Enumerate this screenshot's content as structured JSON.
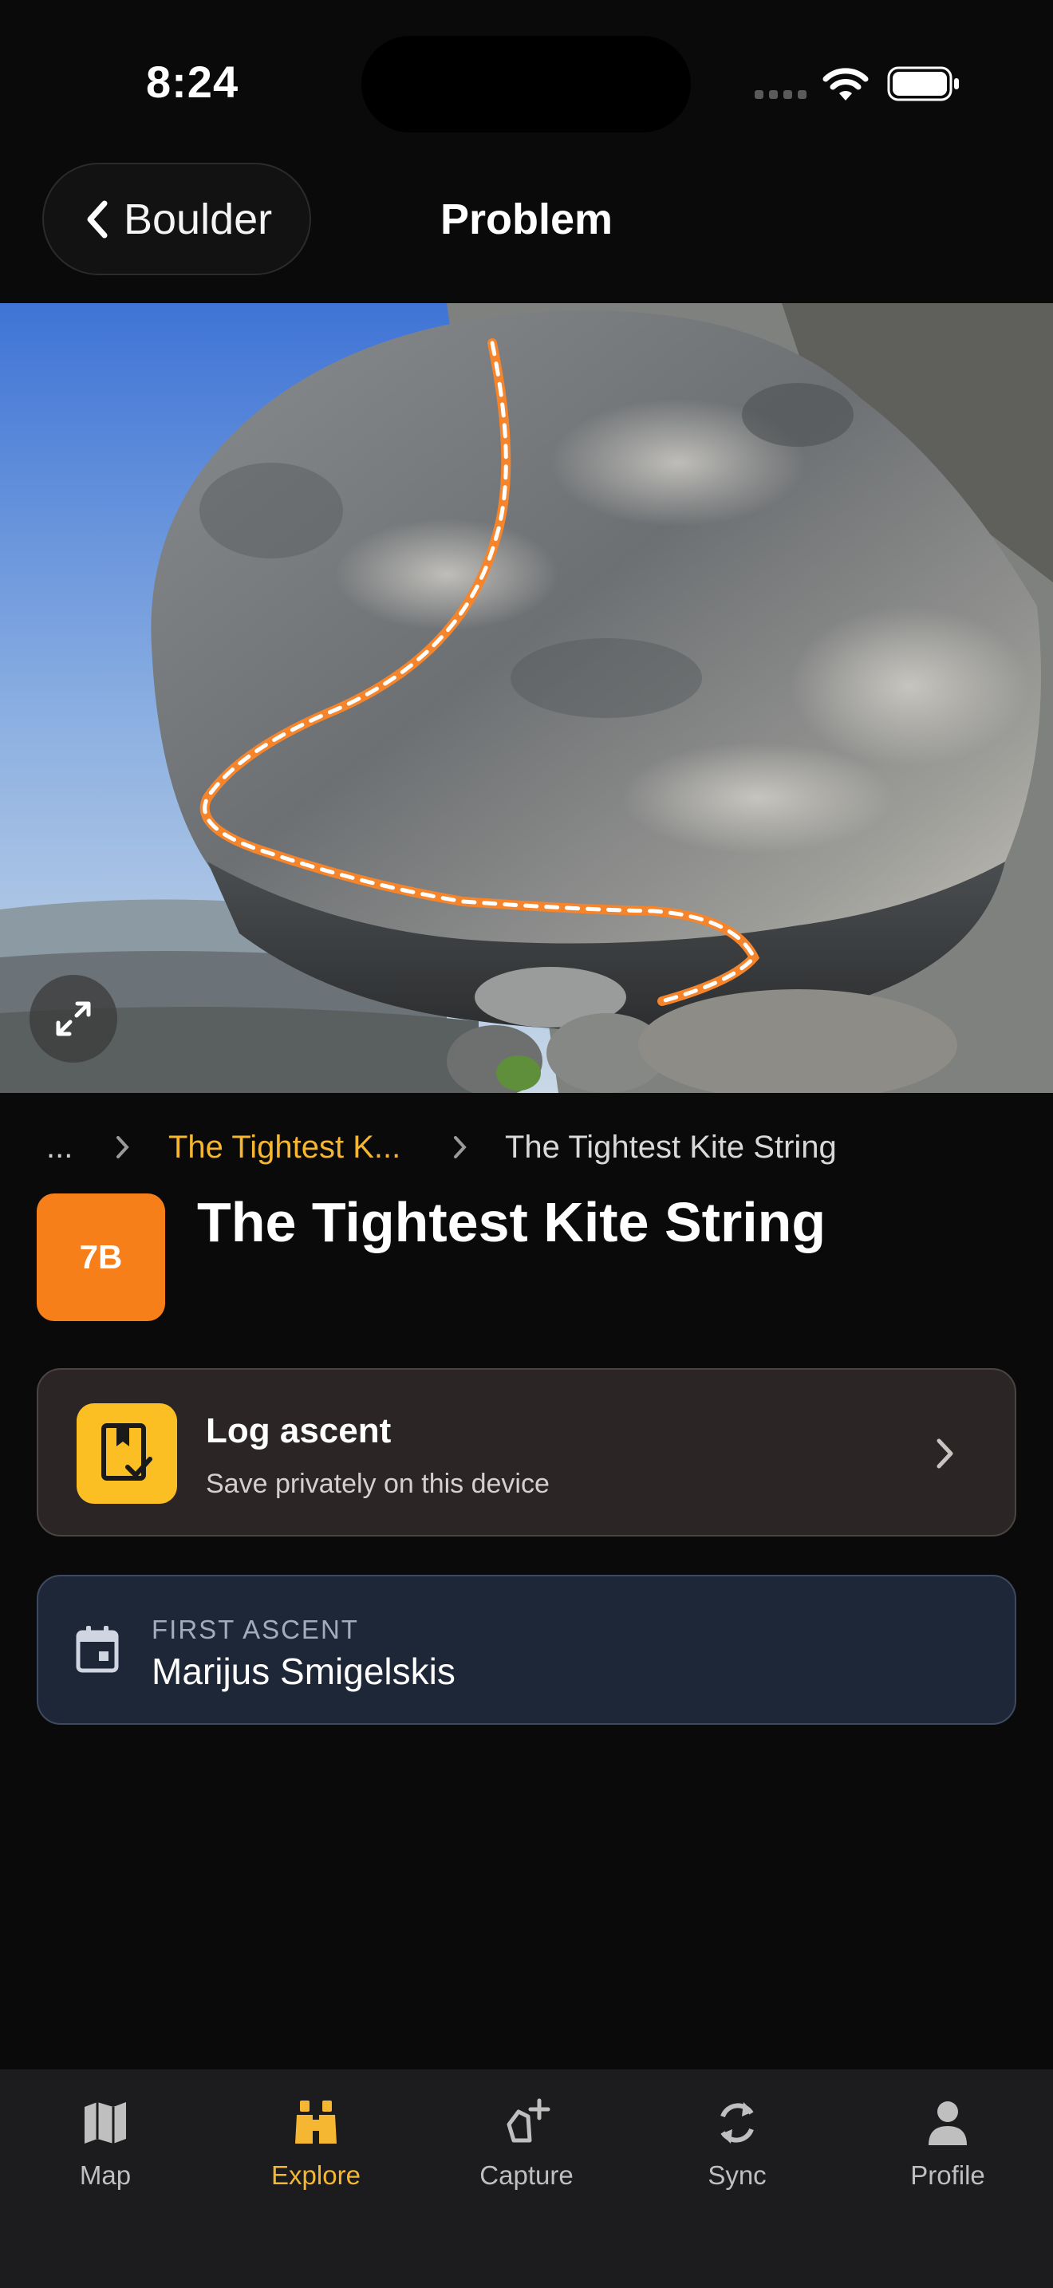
{
  "status_bar": {
    "time": "8:24"
  },
  "header": {
    "back_label": "Boulder",
    "title": "Problem"
  },
  "breadcrumb": {
    "ellipsis": "...",
    "items": [
      "The Tightest K...",
      "The Tightest Kite String"
    ]
  },
  "problem": {
    "grade": "7B",
    "name": "The Tightest Kite String",
    "grade_color": "#f77f19"
  },
  "log_ascent": {
    "title": "Log ascent",
    "subtitle": "Save privately on this device"
  },
  "first_ascent": {
    "label": "FIRST ASCENT",
    "value": "Marijus Smigelskis"
  },
  "tabs": [
    {
      "label": "Map",
      "icon": "map-icon"
    },
    {
      "label": "Explore",
      "icon": "binoculars-icon",
      "active": true
    },
    {
      "label": "Capture",
      "icon": "capture-icon"
    },
    {
      "label": "Sync",
      "icon": "sync-icon"
    },
    {
      "label": "Profile",
      "icon": "profile-icon"
    }
  ],
  "colors": {
    "accent": "#f5b731",
    "background": "#0a0a0a",
    "route_line": "#f5842a"
  }
}
